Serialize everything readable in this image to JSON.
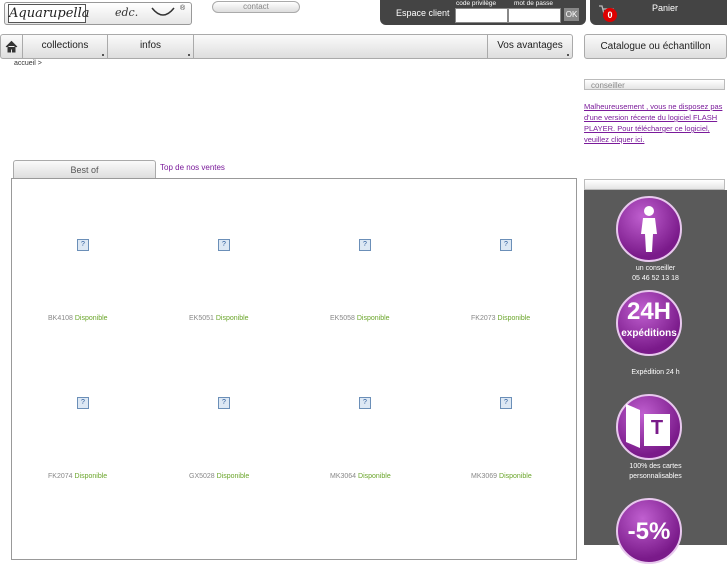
{
  "header": {
    "logo_text": "Aquarupella",
    "logo_edc": "edc.",
    "logo_reg": "®",
    "contact_label": "contact",
    "espace_client_label": "Espace client",
    "code_privilege_label": "code privilège",
    "mot_de_passe_label": "mot de passe",
    "ok_label": "OK",
    "cart_count": "0",
    "panier_label": "Panier"
  },
  "nav": {
    "items": [
      {
        "label": "collections"
      },
      {
        "label": "infos"
      },
      {
        "label": "Vos avantages"
      }
    ],
    "catalogue_label": "Catalogue ou échantillon"
  },
  "breadcrumb": "accueil >",
  "conseiller": {
    "title": "conseiller",
    "message": "Malheureusement , vous ne disposez pas d'une version récente du logiciel FLASH PLAYER. Pour télécharger ce logiciel, veuillez cliquer ici."
  },
  "tabs": {
    "best_of": "Best of",
    "top_ventes": "Top de nos ventes"
  },
  "products": [
    {
      "ref": "BK4108",
      "status": "Disponible"
    },
    {
      "ref": "EK5051",
      "status": "Disponible"
    },
    {
      "ref": "EK5058",
      "status": "Disponible"
    },
    {
      "ref": "FK2073",
      "status": "Disponible"
    },
    {
      "ref": "FK2074",
      "status": "Disponible"
    },
    {
      "ref": "GX5028",
      "status": "Disponible"
    },
    {
      "ref": "MK3064",
      "status": "Disponible"
    },
    {
      "ref": "MK3069",
      "status": "Disponible"
    }
  ],
  "advantages": [
    {
      "caption_1": "un conseiller",
      "caption_2": "05 46 52 13 18"
    },
    {
      "big": "24H",
      "small": "expéditions",
      "caption_1": "Expédition 24 h"
    },
    {
      "letter": "T",
      "caption_1": "100% des cartes",
      "caption_2": "personnalisables"
    },
    {
      "big": "-5%"
    }
  ],
  "colors": {
    "accent_purple": "#7a1a9a",
    "available_green": "#6aa52a",
    "dark_bar": "#444444",
    "badge_red": "#dd0000"
  }
}
